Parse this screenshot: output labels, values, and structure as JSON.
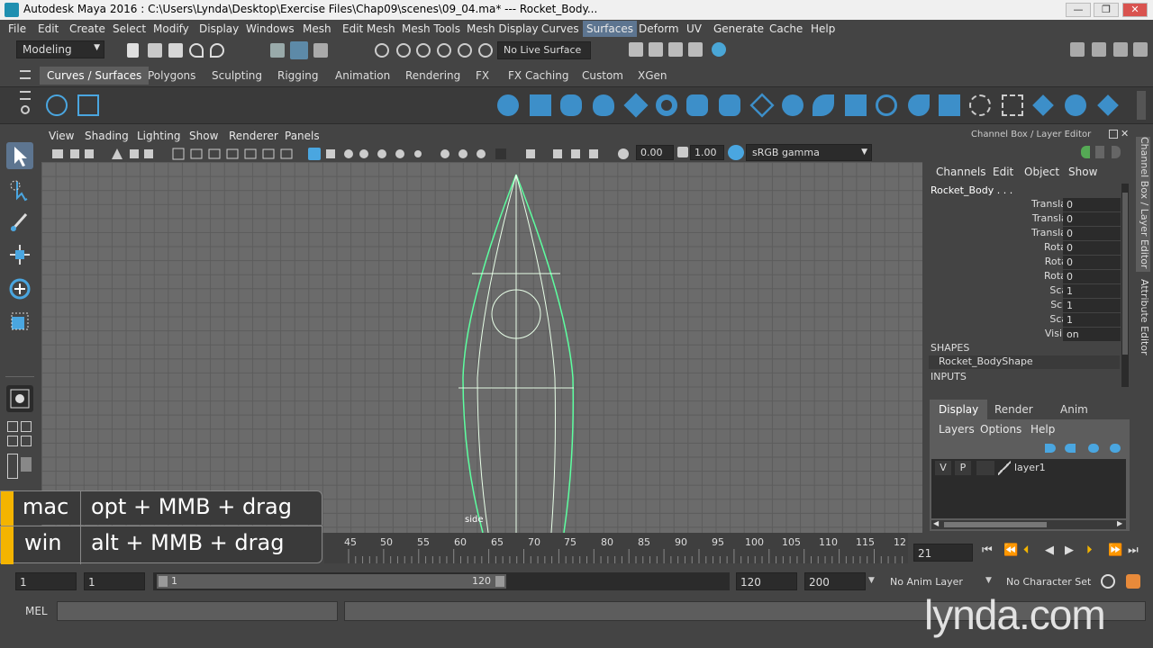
{
  "window": {
    "title": "Autodesk Maya 2016 : C:\\Users\\Lynda\\Desktop\\Exercise Files\\Chap09\\scenes\\09_04.ma*   ---   Rocket_Body...",
    "minimize": "—",
    "maximize": "❐",
    "close": "✕"
  },
  "menubar": {
    "items": [
      "File",
      "Edit",
      "Create",
      "Select",
      "Modify",
      "Display",
      "Windows",
      "Mesh",
      "Edit Mesh",
      "Mesh Tools",
      "Mesh Display",
      "Curves",
      "Surfaces",
      "Deform",
      "UV",
      "Generate",
      "Cache",
      "Help"
    ]
  },
  "statusline": {
    "mode": "Modeling",
    "live_surface": "No Live Surface"
  },
  "shelf": {
    "tabs": [
      "Curves / Surfaces",
      "Polygons",
      "Sculpting",
      "Rigging",
      "Animation",
      "Rendering",
      "FX",
      "FX Caching",
      "Custom",
      "XGen"
    ],
    "active": "Curves / Surfaces"
  },
  "viewport": {
    "menu": [
      "View",
      "Shading",
      "Lighting",
      "Show",
      "Renderer",
      "Panels"
    ],
    "exposure": "0.00",
    "gamma": "1.00",
    "colorspace": "sRGB gamma",
    "camera_label": "side"
  },
  "channelbox": {
    "header": "Channel Box / Layer Editor",
    "menu": [
      "Channels",
      "Edit",
      "Object",
      "Show"
    ],
    "object": "Rocket_Body . . .",
    "attributes": [
      {
        "name": "Translate X",
        "value": "0"
      },
      {
        "name": "Translate Y",
        "value": "0"
      },
      {
        "name": "Translate Z",
        "value": "0"
      },
      {
        "name": "Rotate X",
        "value": "0"
      },
      {
        "name": "Rotate Y",
        "value": "0"
      },
      {
        "name": "Rotate Z",
        "value": "0"
      },
      {
        "name": "Scale X",
        "value": "1"
      },
      {
        "name": "Scale Y",
        "value": "1"
      },
      {
        "name": "Scale Z",
        "value": "1"
      },
      {
        "name": "Visibility",
        "value": "on"
      }
    ],
    "shapes_header": "SHAPES",
    "shape": "Rocket_BodyShape",
    "inputs_header": "INPUTS"
  },
  "layereditor": {
    "tabs": [
      "Display",
      "Render",
      "Anim"
    ],
    "menu": [
      "Layers",
      "Options",
      "Help"
    ],
    "layer": {
      "v": "V",
      "p": "P",
      "name": "layer1"
    }
  },
  "righttabs": [
    "Channel Box / Layer Editor",
    "Attribute Editor"
  ],
  "timeslider": {
    "ticks": [
      "45",
      "50",
      "55",
      "60",
      "65",
      "70",
      "75",
      "80",
      "85",
      "90",
      "95",
      "100",
      "105",
      "110",
      "115",
      "12"
    ],
    "current_frame": "21"
  },
  "rangeslider": {
    "start": "1",
    "playback_start": "1",
    "range_start": "1",
    "range_end": "120",
    "playback_end": "120",
    "end": "200",
    "anim_layer": "No Anim Layer",
    "character_set": "No Character Set"
  },
  "cmdline": {
    "label": "MEL"
  },
  "shortcut": {
    "mac_os": "mac",
    "mac_keys": "opt + MMB + drag",
    "win_os": "win",
    "win_keys": "alt + MMB + drag"
  },
  "watermark": "lynda.com",
  "colors": {
    "accent_yellow": "#f4b400",
    "curve_green": "#5dffa0",
    "ui_bg": "#444444"
  }
}
